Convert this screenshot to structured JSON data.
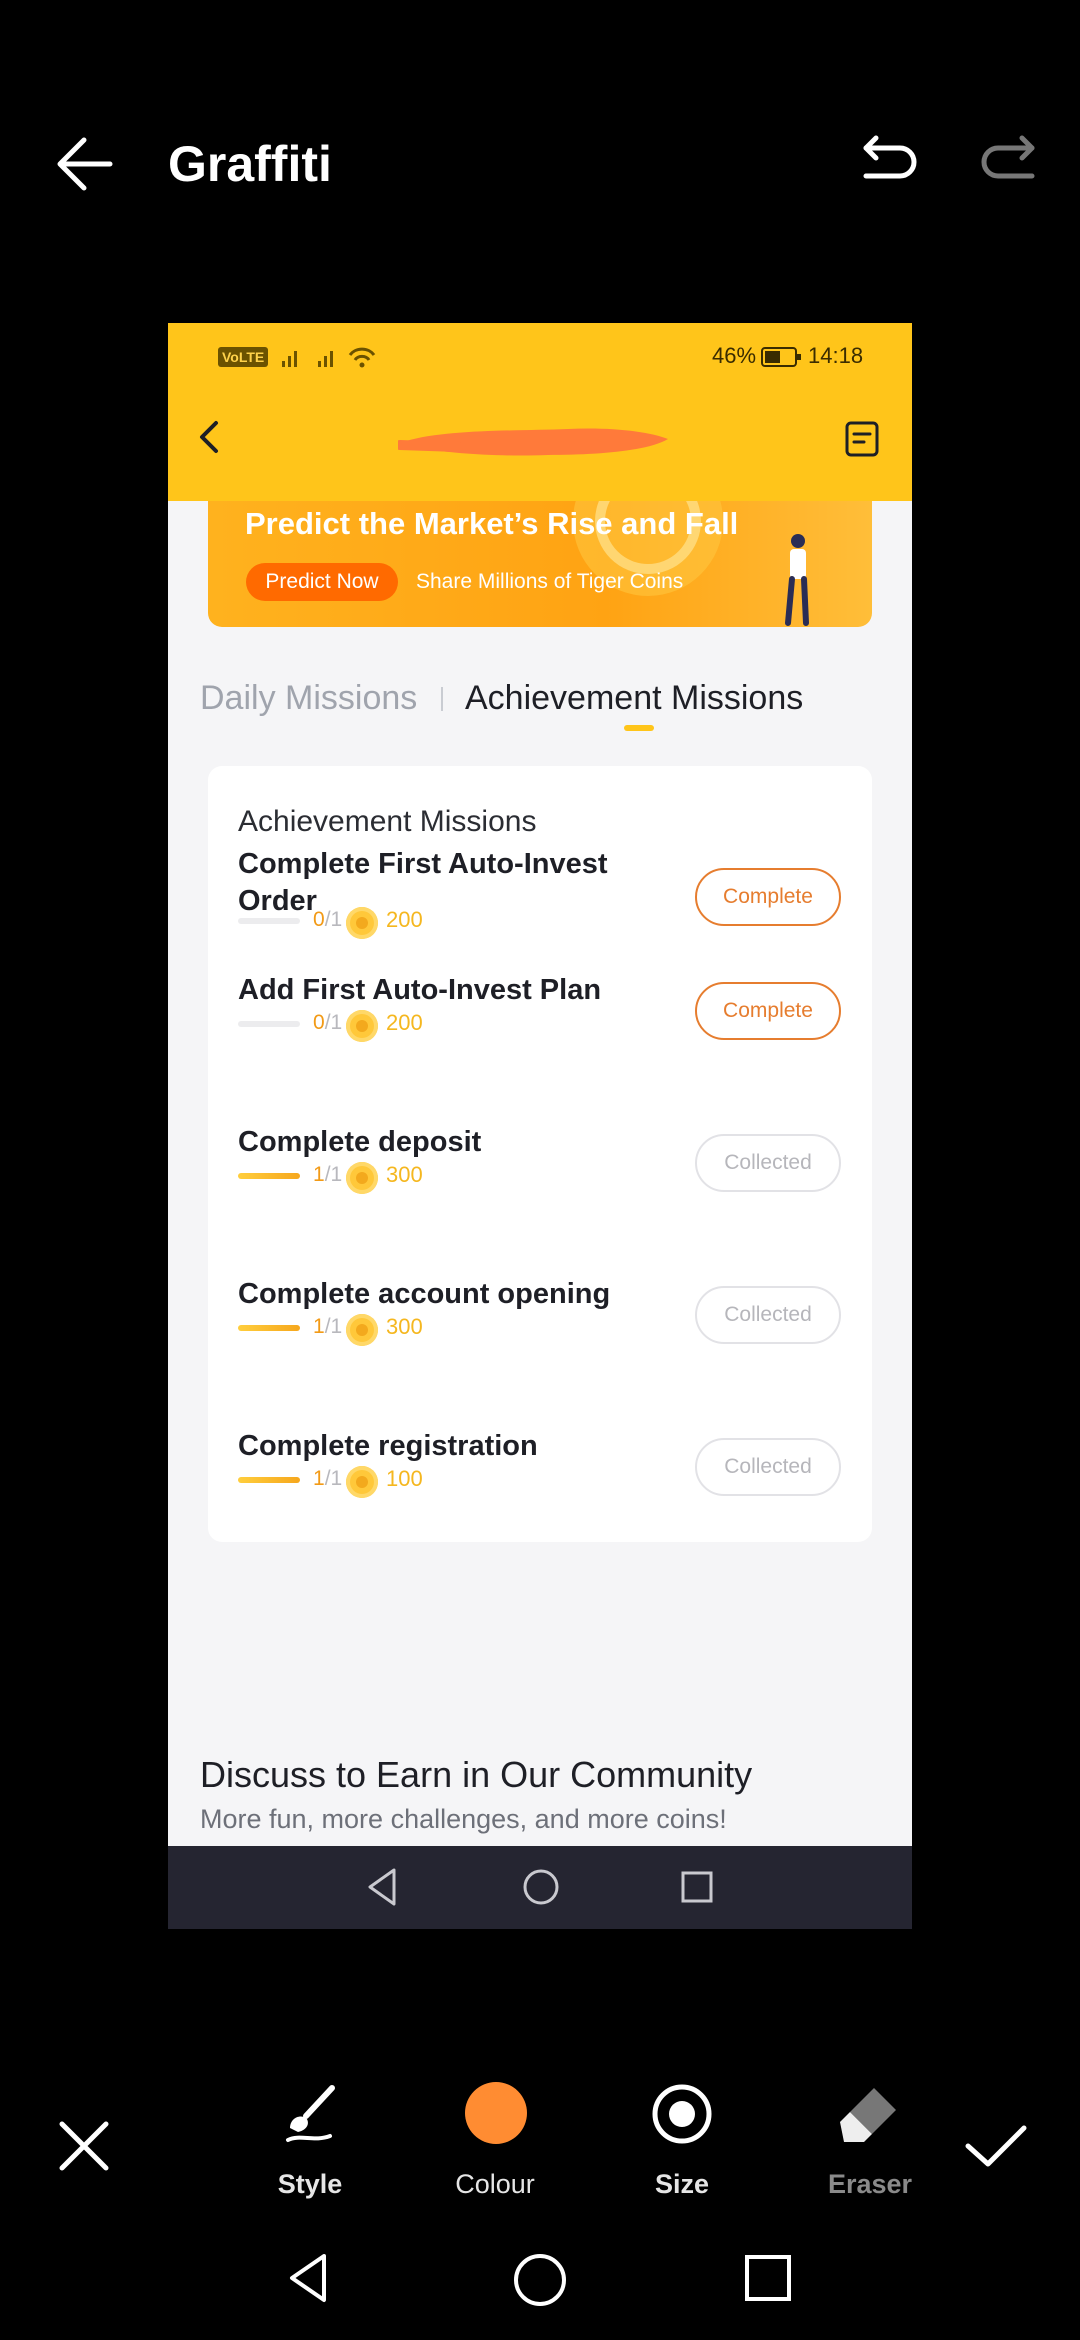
{
  "editor": {
    "title": "Graffiti",
    "toolbar": [
      {
        "label": "Style",
        "icon": "brush-icon"
      },
      {
        "label": "Colour",
        "icon": "colour-dot"
      },
      {
        "label": "Size",
        "icon": "size-ring-icon"
      },
      {
        "label": "Eraser",
        "icon": "eraser-icon"
      }
    ],
    "brush_colour": "#ff8c32"
  },
  "status_bar": {
    "network": "VoLTE",
    "battery": "46%",
    "time": "14:18"
  },
  "banner": {
    "title": "Predict the Market’s Rise and Fall",
    "button": "Predict Now",
    "subtitle": "Share Millions of Tiger Coins"
  },
  "tabs": [
    {
      "label": "Daily Missions",
      "active": false
    },
    {
      "label": "Achievement Missions",
      "active": true
    }
  ],
  "card": {
    "title": "Achievement Missions",
    "missions": [
      {
        "title": "Complete First Auto-Invest Order",
        "done": "0",
        "total": "/1",
        "points": "200",
        "progress": 0,
        "button": "Complete"
      },
      {
        "title": "Add First Auto-Invest Plan",
        "done": "0",
        "total": "/1",
        "points": "200",
        "progress": 0,
        "button": "Complete"
      },
      {
        "title": "Complete deposit",
        "done": "1",
        "total": "/1",
        "points": "300",
        "progress": 1,
        "button": "Collected"
      },
      {
        "title": "Complete account opening",
        "done": "1",
        "total": "/1",
        "points": "300",
        "progress": 1,
        "button": "Collected"
      },
      {
        "title": "Complete registration",
        "done": "1",
        "total": "/1",
        "points": "100",
        "progress": 1,
        "button": "Collected"
      }
    ]
  },
  "community": {
    "title": "Discuss to Earn in Our Community",
    "subtitle": "More fun, more challenges, and more coins!"
  },
  "colors": {
    "accent_yellow": "#ffc51a",
    "complete_orange": "#e67d2f",
    "scribble": "#ff7a3a"
  }
}
